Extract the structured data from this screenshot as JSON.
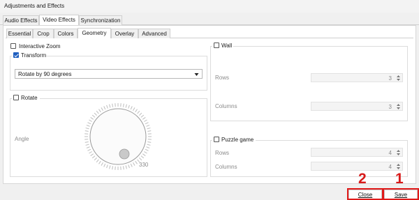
{
  "window": {
    "title": "Adjustments and Effects"
  },
  "main_tabs": [
    {
      "label": "Audio Effects"
    },
    {
      "label": "Video Effects"
    },
    {
      "label": "Synchronization"
    }
  ],
  "sub_tabs": [
    {
      "label": "Essential"
    },
    {
      "label": "Crop"
    },
    {
      "label": "Colors"
    },
    {
      "label": "Geometry"
    },
    {
      "label": "Overlay"
    },
    {
      "label": "Advanced"
    }
  ],
  "geometry": {
    "interactive_zoom": {
      "label": "Interactive Zoom",
      "checked": false
    },
    "transform": {
      "label": "Transform",
      "checked": true,
      "selected": "Rotate by 90 degrees"
    },
    "rotate": {
      "label": "Rotate",
      "checked": false,
      "angle_label": "Angle",
      "angle_value": "330"
    },
    "wall": {
      "label": "Wall",
      "checked": false,
      "rows_label": "Rows",
      "rows_value": "3",
      "columns_label": "Columns",
      "columns_value": "3"
    },
    "puzzle": {
      "label": "Puzzle game",
      "checked": false,
      "rows_label": "Rows",
      "rows_value": "4",
      "columns_label": "Columns",
      "columns_value": "4"
    }
  },
  "buttons": {
    "close": "Close",
    "save": "Save"
  },
  "annotations": {
    "close_number": "2",
    "save_number": "1",
    "highlight_color": "#e01a1a"
  }
}
